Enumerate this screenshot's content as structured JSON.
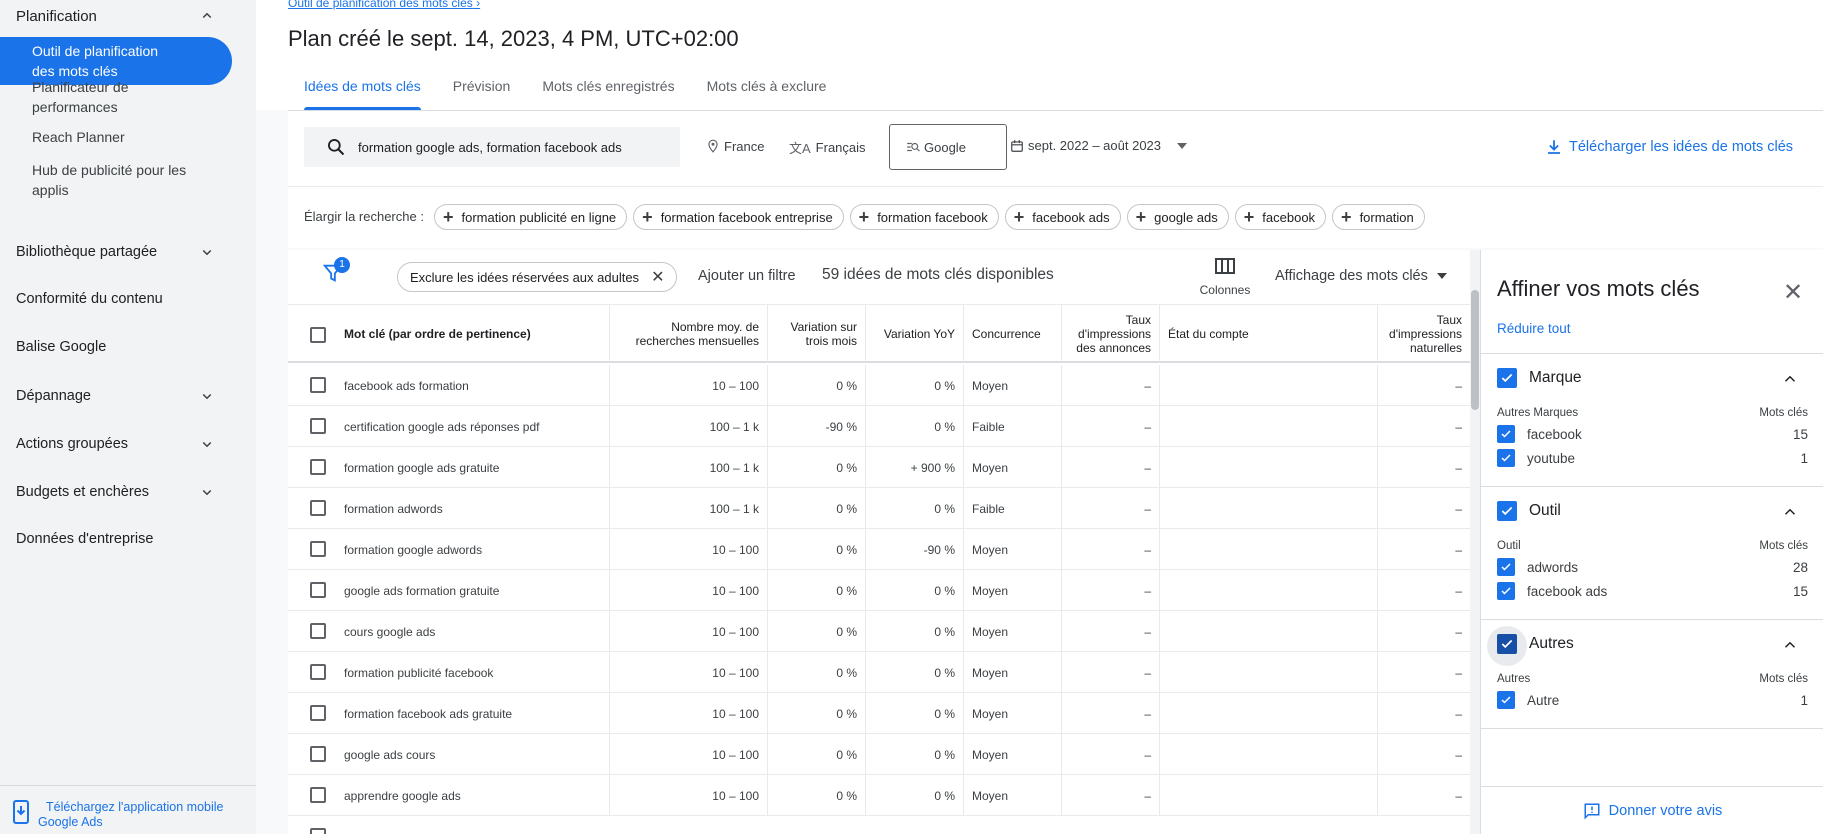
{
  "sidebar": {
    "section": "Planification",
    "items_sub": [
      {
        "label": "Outil de planification\ndes mots clés",
        "l1": "Outil de planification",
        "l2": "des mots clés"
      },
      {
        "l1": "Planificateur de",
        "l2": "performances"
      },
      {
        "l1": "Reach Planner",
        "l2": ""
      },
      {
        "l1": "Hub de publicité pour les",
        "l2": "applis"
      }
    ],
    "items": [
      {
        "label": "Bibliothèque partagée",
        "chevron": true
      },
      {
        "label": "Conformité du contenu",
        "chevron": false
      },
      {
        "label": "Balise Google",
        "chevron": false
      },
      {
        "label": "Dépannage",
        "chevron": true
      },
      {
        "label": "Actions groupées",
        "chevron": true
      },
      {
        "label": "Budgets et enchères",
        "chevron": true
      },
      {
        "label": "Données d'entreprise",
        "chevron": false
      }
    ],
    "footer_l1": "Téléchargez l'application mobile",
    "footer_l2": "Google Ads"
  },
  "breadcrumb": "Outil de planification des mots clés",
  "title": "Plan créé le sept. 14, 2023, 4 PM, UTC+02:00",
  "tabs": [
    "Idées de mots clés",
    "Prévision",
    "Mots clés enregistrés",
    "Mots clés à exclure"
  ],
  "search": {
    "value": "formation google ads, formation facebook ads",
    "location": "France",
    "language": "Français",
    "engine": "Google",
    "date_range": "sept. 2022 – août 2023",
    "download": "Télécharger les idées de mots clés"
  },
  "broaden": {
    "label": "Élargir la recherche :",
    "chips": [
      "formation publicité en ligne",
      "formation facebook entreprise",
      "formation facebook",
      "facebook ads",
      "google ads",
      "facebook",
      "formation"
    ]
  },
  "filters": {
    "badge": "1",
    "chip": "Exclure les idées réservées aux adultes",
    "add": "Ajouter un filtre",
    "count": "59 idées de mots clés disponibles",
    "columns": "Colonnes",
    "view": "Affichage des mots clés"
  },
  "table": {
    "headers": {
      "keyword": "Mot clé (par ordre de pertinence)",
      "avg_l1": "Nombre moy. de",
      "avg_l2": "recherches mensuelles",
      "tm_l1": "Variation sur",
      "tm_l2": "trois mois",
      "yoy": "Variation YoY",
      "comp": "Concurrence",
      "imp_l1": "Taux",
      "imp_l2": "d'impressions",
      "imp_l3": "des annonces",
      "state": "État du compte",
      "nat_l1": "Taux",
      "nat_l2": "d'impressions",
      "nat_l3": "naturelles"
    },
    "rows": [
      {
        "keyword": "facebook ads formation",
        "avg": "10 – 100",
        "tm": "0 %",
        "yoy": "0 %",
        "comp": "Moyen",
        "imp": "–",
        "nat": "–"
      },
      {
        "keyword": "certification google ads réponses pdf",
        "avg": "100 – 1 k",
        "tm": "-90 %",
        "yoy": "0 %",
        "comp": "Faible",
        "imp": "–",
        "nat": "–"
      },
      {
        "keyword": "formation google ads gratuite",
        "avg": "100 – 1 k",
        "tm": "0 %",
        "yoy": "+ 900 %",
        "comp": "Moyen",
        "imp": "–",
        "nat": "–"
      },
      {
        "keyword": "formation adwords",
        "avg": "100 – 1 k",
        "tm": "0 %",
        "yoy": "0 %",
        "comp": "Faible",
        "imp": "–",
        "nat": "–"
      },
      {
        "keyword": "formation google adwords",
        "avg": "10 – 100",
        "tm": "0 %",
        "yoy": "-90 %",
        "comp": "Moyen",
        "imp": "–",
        "nat": "–"
      },
      {
        "keyword": "google ads formation gratuite",
        "avg": "10 – 100",
        "tm": "0 %",
        "yoy": "0 %",
        "comp": "Moyen",
        "imp": "–",
        "nat": "–"
      },
      {
        "keyword": "cours google ads",
        "avg": "10 – 100",
        "tm": "0 %",
        "yoy": "0 %",
        "comp": "Moyen",
        "imp": "–",
        "nat": "–"
      },
      {
        "keyword": "formation publicité facebook",
        "avg": "10 – 100",
        "tm": "0 %",
        "yoy": "0 %",
        "comp": "Moyen",
        "imp": "–",
        "nat": "–"
      },
      {
        "keyword": "formation facebook ads gratuite",
        "avg": "10 – 100",
        "tm": "0 %",
        "yoy": "0 %",
        "comp": "Moyen",
        "imp": "–",
        "nat": "–"
      },
      {
        "keyword": "google ads cours",
        "avg": "10 – 100",
        "tm": "0 %",
        "yoy": "0 %",
        "comp": "Moyen",
        "imp": "–",
        "nat": "–"
      },
      {
        "keyword": "apprendre google ads",
        "avg": "10 – 100",
        "tm": "0 %",
        "yoy": "0 %",
        "comp": "Moyen",
        "imp": "–",
        "nat": "–"
      }
    ]
  },
  "panel": {
    "title": "Affiner vos mots clés",
    "reduce": "Réduire tout",
    "sections": [
      {
        "title": "Marque",
        "sub_left": "Autres Marques",
        "sub_right": "Mots clés",
        "items": [
          {
            "label": "facebook",
            "count": "15"
          },
          {
            "label": "youtube",
            "count": "1"
          }
        ]
      },
      {
        "title": "Outil",
        "sub_left": "Outil",
        "sub_right": "Mots clés",
        "items": [
          {
            "label": "adwords",
            "count": "28"
          },
          {
            "label": "facebook ads",
            "count": "15"
          }
        ]
      },
      {
        "title": "Autres",
        "sub_left": "Autres",
        "sub_right": "Mots clés",
        "items": [
          {
            "label": "Autre",
            "count": "1"
          }
        ]
      }
    ],
    "feedback": "Donner votre avis"
  },
  "colors": {
    "accent": "#1a73e8",
    "sidebar_bg": "#f1f3f4"
  }
}
